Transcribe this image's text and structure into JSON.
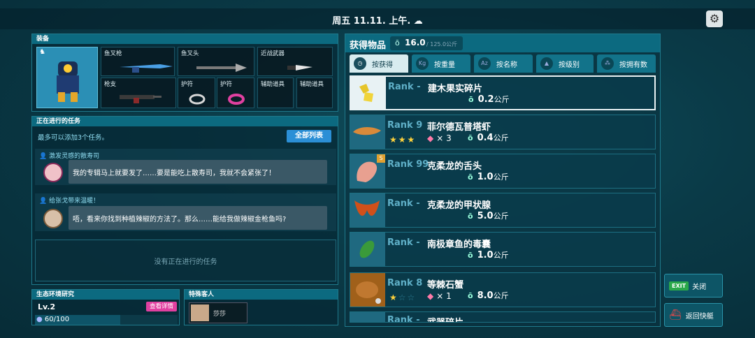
{
  "header": {
    "datetime": "周五 11.11. 上午. ☁"
  },
  "equipment": {
    "title": "装备",
    "slots": [
      {
        "label": "鱼叉枪"
      },
      {
        "label": "鱼叉头"
      },
      {
        "label": "近战武器"
      },
      {
        "label": "枪支"
      },
      {
        "label": "护符"
      },
      {
        "label": "护符"
      },
      {
        "label": "辅助道具"
      },
      {
        "label": "辅助道具"
      }
    ]
  },
  "missions": {
    "title": "正在进行的任务",
    "limit_text": "最多可以添加3个任务。",
    "all_list_label": "全部列表",
    "items": [
      {
        "title": "激发灵感的散寿司",
        "message": "我的专辑马上就要发了……要是能吃上散寿司，我就不会紧张了！"
      },
      {
        "title": "给张戈带来温暖！",
        "message": "唔，看来你找到种植辣椒的方法了。那么……能给我做辣椒金枪鱼吗?"
      }
    ],
    "empty_text": "没有正在进行的任务"
  },
  "eco": {
    "title": "生态环境研究",
    "level": "Lv.2",
    "view_label": "查看详情",
    "progress_text": "60/100",
    "progress": 0.6
  },
  "guest": {
    "title": "特殊客人",
    "name": "莎莎"
  },
  "obtained": {
    "title": "获得物品",
    "weight": "16.0",
    "capacity": "/ 125.0公斤",
    "tabs": [
      "按获得",
      "按重量",
      "按名称",
      "按级别",
      "按拥有数"
    ],
    "items": [
      {
        "rank": "Rank -",
        "name": "建木果实碎片",
        "weight": "0.2",
        "unit": "公斤",
        "stars": 0,
        "count": ""
      },
      {
        "rank": "Rank 9",
        "name": "菲尔德瓦普塔虾",
        "weight": "0.4",
        "unit": "公斤",
        "stars": 3,
        "count": "× 3"
      },
      {
        "rank": "Rank 99",
        "name": "克柔龙的舌头",
        "weight": "1.0",
        "unit": "公斤",
        "stars": 0,
        "count": ""
      },
      {
        "rank": "Rank -",
        "name": "克柔龙的甲状腺",
        "weight": "5.0",
        "unit": "公斤",
        "stars": 0,
        "count": ""
      },
      {
        "rank": "Rank -",
        "name": "南极章鱼的毒囊",
        "weight": "1.0",
        "unit": "公斤",
        "stars": 0,
        "count": ""
      },
      {
        "rank": "Rank 8",
        "name": "等棘石蟹",
        "weight": "8.0",
        "unit": "公斤",
        "stars": 1,
        "count": "× 1"
      },
      {
        "rank": "Rank -",
        "name": "武器碎片",
        "weight": "",
        "unit": "",
        "stars": 0,
        "count": ""
      }
    ]
  },
  "side": {
    "close_label": "关闭",
    "exit_label": "EXIT",
    "return_label": "返回快艇"
  },
  "colors": {
    "accent": "#0c6a80",
    "button": "#2b8fd6",
    "star": "#ffd23c",
    "pink": "#e040a0"
  }
}
